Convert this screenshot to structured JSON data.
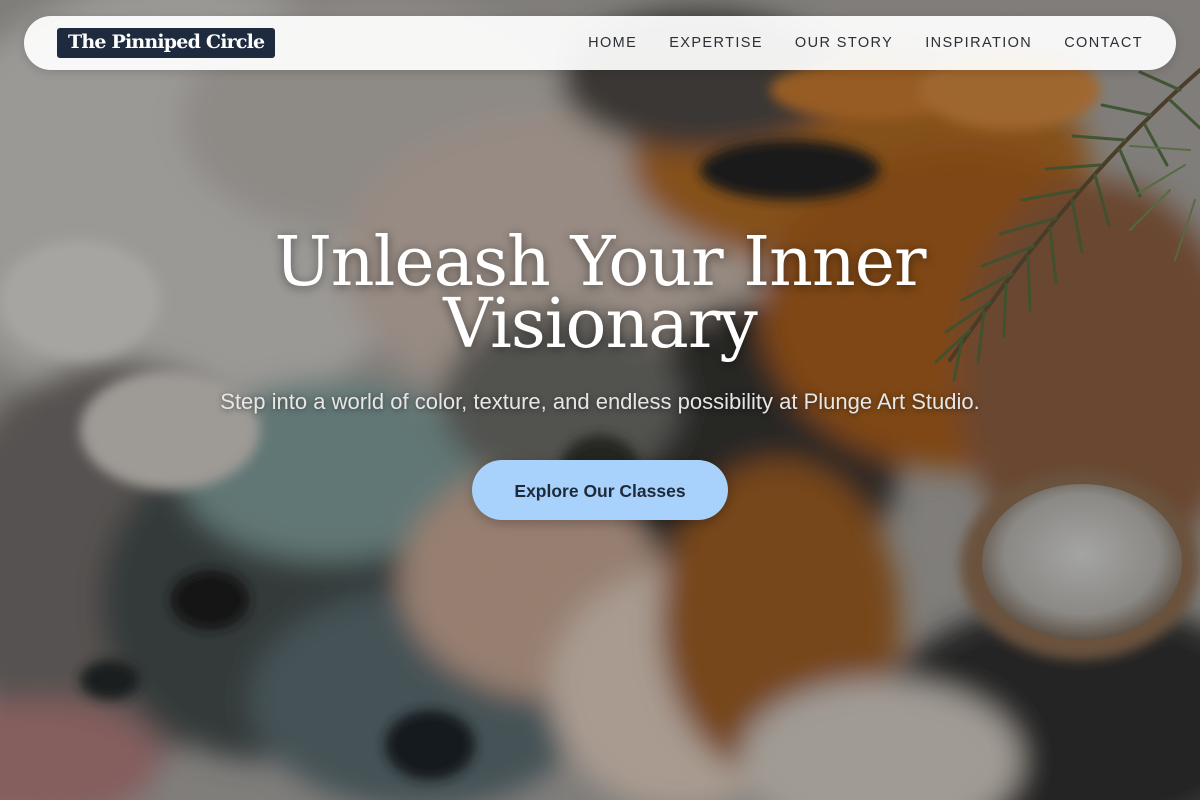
{
  "brand": {
    "name": "The Pinniped Circle"
  },
  "nav": {
    "items": [
      {
        "label": "HOME"
      },
      {
        "label": "EXPERTISE"
      },
      {
        "label": "OUR STORY"
      },
      {
        "label": "INSPIRATION"
      },
      {
        "label": "CONTACT"
      }
    ]
  },
  "hero": {
    "title": "Unleash Your Inner Visionary",
    "subtitle": "Step into a world of color, texture, and endless possibility at Plunge Art Studio.",
    "cta_label": "Explore Our Classes",
    "background_image": "close-up of an artist's oil paint palette with textured paint and a rosemary sprig"
  },
  "colors": {
    "logo_bg": "#1e2a3d",
    "nav_bg": "#ffffff",
    "nav_text": "#2b2f36",
    "cta_bg": "#a8d1fb",
    "cta_text": "#1f2a38",
    "hero_text": "#ffffff"
  }
}
